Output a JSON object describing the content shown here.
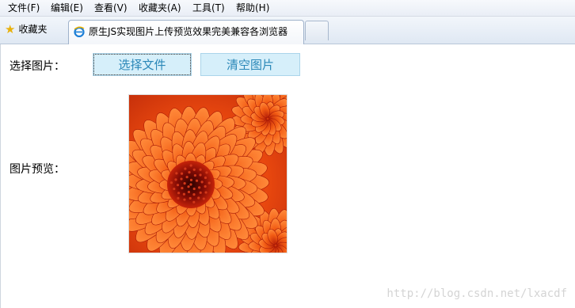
{
  "menu": {
    "items": [
      "文件(F)",
      "编辑(E)",
      "查看(V)",
      "收藏夹(A)",
      "工具(T)",
      "帮助(H)"
    ]
  },
  "favorites": {
    "label": "收藏夹",
    "icon": "star-icon"
  },
  "tab": {
    "title": "原生JS实现图片上传预览效果完美兼容各浏览器",
    "icon": "ie-icon"
  },
  "form": {
    "select_label": "选择图片：",
    "choose_button": "选择文件",
    "clear_button": "清空图片",
    "preview_label": "图片预览："
  },
  "watermark": "http://blog.csdn.net/lxacdf",
  "colors": {
    "button_bg": "#d6effa",
    "button_text": "#2a87b8",
    "flower_orange": "#f05a12",
    "flower_center": "#8c0d06"
  }
}
